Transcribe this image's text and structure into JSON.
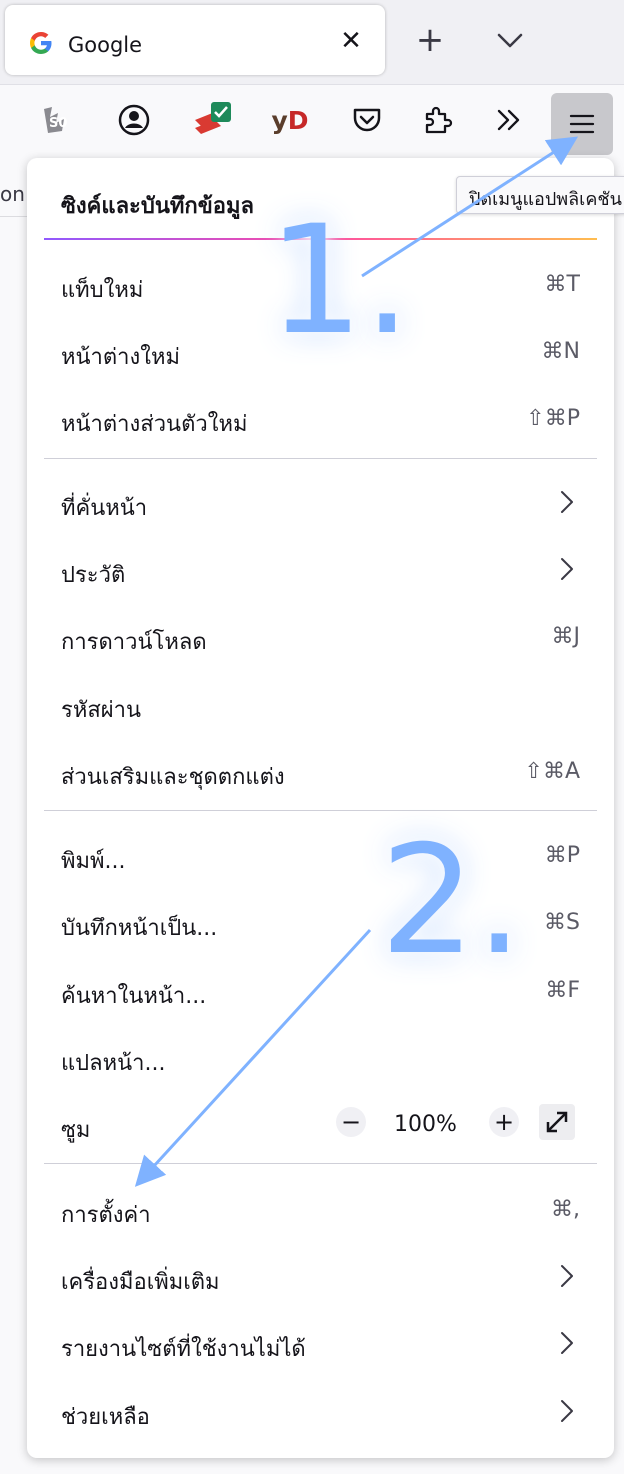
{
  "tab": {
    "title": "Google",
    "close_symbol": "✕"
  },
  "tabstrip": {
    "new_tab_symbol": "+"
  },
  "toolbar": {
    "yd_y": "y",
    "yd_d": "D"
  },
  "page_fragment": "on",
  "tooltip": "ปิดเมนูแอปพลิเคชัน",
  "menu": {
    "sync": "ซิงค์และบันทึกข้อมูล",
    "items": [
      {
        "label": "แท็บใหม่",
        "shortcut": "⌘T"
      },
      {
        "label": "หน้าต่างใหม่",
        "shortcut": "⌘N"
      },
      {
        "label": "หน้าต่างส่วนตัวใหม่",
        "shortcut": "⇧⌘P"
      },
      {
        "label": "ที่คั่นหน้า",
        "shortcut": ""
      },
      {
        "label": "ประวัติ",
        "shortcut": ""
      },
      {
        "label": "การดาวน์โหลด",
        "shortcut": "⌘J"
      },
      {
        "label": "รหัสผ่าน",
        "shortcut": ""
      },
      {
        "label": "ส่วนเสริมและชุดตกแต่ง",
        "shortcut": "⇧⌘A"
      },
      {
        "label": "พิมพ์...",
        "shortcut": "⌘P"
      },
      {
        "label": "บันทึกหน้าเป็น...",
        "shortcut": "⌘S"
      },
      {
        "label": "ค้นหาในหน้า...",
        "shortcut": "⌘F"
      },
      {
        "label": "แปลหน้า...",
        "shortcut": ""
      },
      {
        "label": "ซูม",
        "shortcut": ""
      },
      {
        "label": "การตั้งค่า",
        "shortcut": "⌘,"
      },
      {
        "label": "เครื่องมือเพิ่มเติม",
        "shortcut": ""
      },
      {
        "label": "รายงานไซต์ที่ใช้งานไม่ได้",
        "shortcut": ""
      },
      {
        "label": "ช่วยเหลือ",
        "shortcut": ""
      }
    ],
    "zoom": {
      "minus": "−",
      "value": "100%",
      "plus": "+"
    }
  },
  "annotations": {
    "step1": "1.",
    "step2": "2."
  },
  "colors": {
    "annotation": "#7fb2ff",
    "accent_gradient": [
      "#9059ff",
      "#ff4aa2",
      "#ffbd4f"
    ]
  },
  "icons": [
    "google-logo-icon",
    "close-icon",
    "plus-icon",
    "chevron-down-icon",
    "s0-extension-icon",
    "account-icon",
    "todoist-extension-icon",
    "yd-extension-icon",
    "pocket-icon",
    "extensions-icon",
    "overflow-icon",
    "hamburger-menu-icon",
    "chevron-right-icon",
    "fullscreen-icon"
  ]
}
